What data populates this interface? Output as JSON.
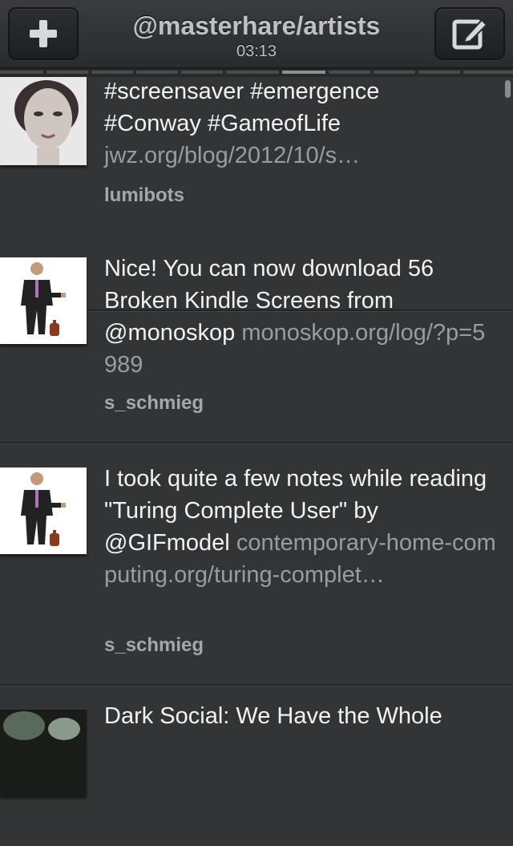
{
  "header": {
    "title": "@masterhare/artists",
    "time": "03:13",
    "add_icon": "plus-icon",
    "compose_icon": "compose-icon"
  },
  "tweets": [
    {
      "text": "#screensaver #emergence #Conway #GameofLife",
      "link": "jwz.org/blog/2012/10/s…",
      "author": "lumibots",
      "avatar": "woman-portrait"
    },
    {
      "text": "Nice! You can now download 56 Broken Kindle Screens from @monoskop",
      "link": "monoskop.org/log/?p=5989",
      "author": "s_schmieg",
      "avatar": "pixel-man"
    },
    {
      "text": "I took quite a few notes while reading \"Turing Complete User\" by @GIFmodel",
      "link": "contemporary-home-computing.org/turing-complet…",
      "author": "s_schmieg",
      "avatar": "pixel-man"
    },
    {
      "text": "Dark Social: We Have the Whole",
      "link": "",
      "author": "",
      "avatar": "dark-photo"
    }
  ],
  "colors": {
    "background": "#333435",
    "text": "#f2f2f2",
    "link": "#9b9c9e",
    "author": "#a6a7a9"
  }
}
